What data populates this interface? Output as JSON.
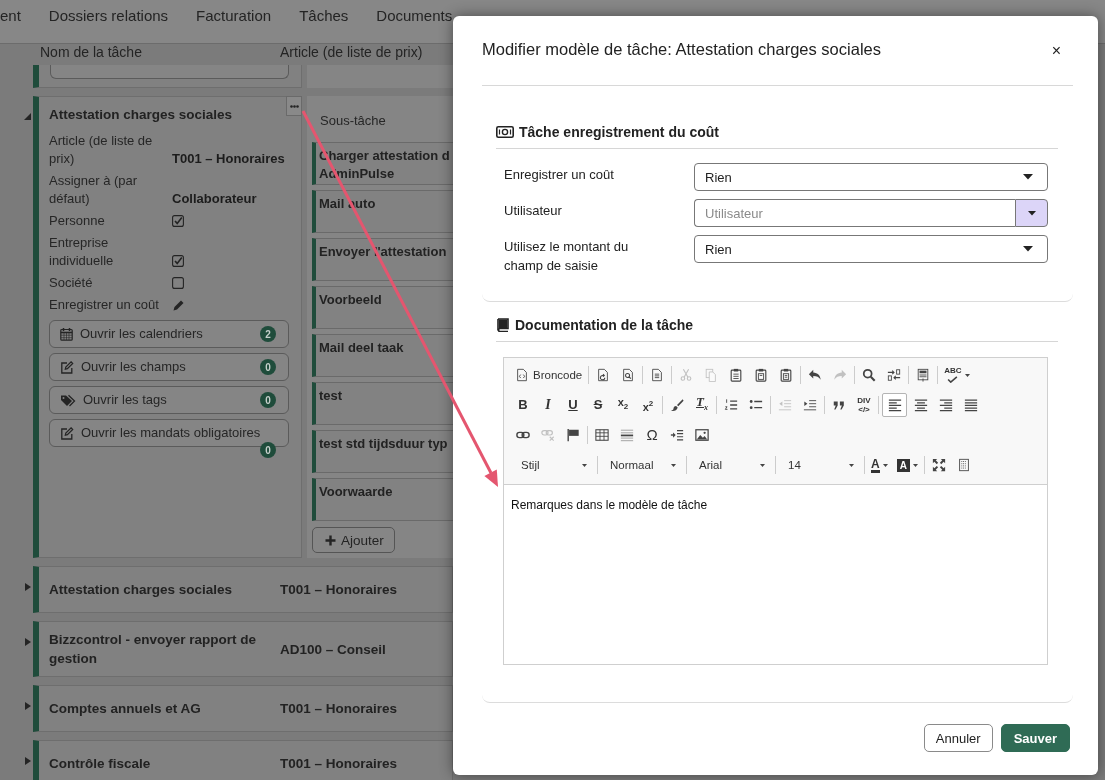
{
  "menu": [
    "ent",
    "Dossiers relations",
    "Facturation",
    "Tâches",
    "Documents"
  ],
  "columns": [
    "Nom de la tâche",
    "Article (de liste de prix)"
  ],
  "tasks": [
    {
      "name": "Attestation charges sociales",
      "expanded": true,
      "fields": [
        {
          "kind": "text",
          "label": "Article (de liste de prix)",
          "value": "T001 – Honoraires"
        },
        {
          "kind": "text",
          "label": "Assigner à (par défaut)",
          "value": "Collaborateur"
        },
        {
          "kind": "checkbox",
          "label": "Personne",
          "checked": true
        },
        {
          "kind": "checkbox",
          "label": "Entreprise individuelle",
          "checked": true
        },
        {
          "kind": "checkbox",
          "label": "Société",
          "checked": false
        },
        {
          "kind": "edit",
          "label": "Enregistrer un coût"
        }
      ],
      "buttons": [
        {
          "kind": "calendar",
          "label": "Ouvrir les calendriers",
          "count": "2"
        },
        {
          "kind": "edit",
          "label": "Ouvrir les champs",
          "count": "0"
        },
        {
          "kind": "tags",
          "label": "Ouvrir les tags",
          "count": "0"
        },
        {
          "kind": "edit",
          "label": "Ouvrir les mandats obligatoires",
          "count": "0"
        }
      ],
      "subtasks_header": "Sous-tâche",
      "subtasks": [
        "Charger attestation d AdminPulse",
        "Mail auto",
        "Envoyer l'attestation",
        "Voorbeeld",
        "Mail deel taak",
        "test",
        "test std tijdsduur typ",
        "Voorwaarde"
      ],
      "add_button": "Ajouter"
    },
    {
      "name": "Attestation charges sociales",
      "article": "T001 – Honoraires",
      "expanded": false
    },
    {
      "name": "Bizzcontrol - envoyer rapport de gestion",
      "article": "AD100 – Conseil",
      "expanded": false
    },
    {
      "name": "Comptes annuels et AG",
      "article": "T001 – Honoraires",
      "expanded": false
    },
    {
      "name": "Contrôle fiscale",
      "article": "T001 – Honoraires",
      "expanded": false
    }
  ],
  "dialog": {
    "title": "Modifier modèle de tâche: Attestation charges sociales",
    "close": "×",
    "sections": [
      {
        "kind": "cost",
        "title": "Tâche enregistrement du coût",
        "fields": [
          {
            "kind": "select",
            "label": "Enregistrer un coût",
            "value": "Rien"
          },
          {
            "kind": "combobox",
            "label": "Utilisateur",
            "placeholder": "Utilisateur"
          },
          {
            "kind": "select",
            "label": "Utilisez le montant du champ de saisie",
            "value": "Rien"
          }
        ]
      },
      {
        "kind": "docs",
        "title": "Documentation de la tâche",
        "editor": {
          "toolbar": {
            "rows": [
              {
                "groups": [
                  {
                    "items": [
                      {
                        "kind": "source",
                        "label": "Broncode",
                        "disabled": false,
                        "on": false
                      }
                    ]
                  },
                  {
                    "items": [
                      {
                        "kind": "template",
                        "disabled": false,
                        "on": false
                      },
                      {
                        "kind": "preview",
                        "disabled": false,
                        "on": false
                      }
                    ]
                  },
                  {
                    "items": [
                      {
                        "kind": "newpage",
                        "disabled": false,
                        "on": false
                      }
                    ]
                  },
                  {
                    "items": [
                      {
                        "kind": "cut",
                        "disabled": true,
                        "on": false
                      },
                      {
                        "kind": "copy",
                        "disabled": true,
                        "on": false
                      },
                      {
                        "kind": "paste",
                        "disabled": false,
                        "on": false
                      },
                      {
                        "kind": "pastetext",
                        "disabled": false,
                        "on": false
                      },
                      {
                        "kind": "pasteword",
                        "disabled": false,
                        "on": false
                      }
                    ]
                  },
                  {
                    "items": [
                      {
                        "kind": "undo",
                        "disabled": false,
                        "on": false
                      },
                      {
                        "kind": "redo",
                        "disabled": true,
                        "on": false
                      }
                    ]
                  },
                  {
                    "items": [
                      {
                        "kind": "find",
                        "disabled": false,
                        "on": false
                      },
                      {
                        "kind": "replace",
                        "disabled": false,
                        "on": false
                      }
                    ]
                  },
                  {
                    "items": [
                      {
                        "kind": "selectall",
                        "disabled": false,
                        "on": false
                      }
                    ]
                  },
                  {
                    "items": [
                      {
                        "kind": "spellcheck",
                        "label": "ABC",
                        "disabled": false,
                        "on": false
                      }
                    ]
                  }
                ]
              },
              {
                "groups": [
                  {
                    "items": [
                      {
                        "kind": "bold",
                        "label": "B",
                        "disabled": false,
                        "on": false
                      },
                      {
                        "kind": "italic",
                        "label": "I",
                        "disabled": false,
                        "on": false
                      },
                      {
                        "kind": "underline",
                        "label": "U",
                        "disabled": false,
                        "on": false
                      },
                      {
                        "kind": "strike",
                        "label": "S",
                        "disabled": false,
                        "on": false
                      },
                      {
                        "kind": "subscript",
                        "label": "x$_{2}$",
                        "disabled": false,
                        "on": false
                      },
                      {
                        "kind": "superscript",
                        "label": "x$^{2}$",
                        "disabled": false,
                        "on": false
                      }
                    ]
                  },
                  {
                    "items": [
                      {
                        "kind": "brush",
                        "disabled": false,
                        "on": false
                      },
                      {
                        "kind": "removeformat",
                        "label": "T$_{x}$",
                        "disabled": false,
                        "on": false
                      }
                    ]
                  },
                  {
                    "items": [
                      {
                        "kind": "numbered",
                        "disabled": false,
                        "on": false
                      },
                      {
                        "kind": "bulleted",
                        "disabled": false,
                        "on": false
                      }
                    ]
                  },
                  {
                    "items": [
                      {
                        "kind": "outdent",
                        "disabled": true,
                        "on": false
                      },
                      {
                        "kind": "indent",
                        "disabled": false,
                        "on": false
                      }
                    ]
                  },
                  {
                    "items": [
                      {
                        "kind": "quote",
                        "disabled": false,
                        "on": false
                      },
                      {
                        "kind": "div",
                        "label": "DIV",
                        "sublabel": "</>",
                        "disabled": false,
                        "on": false
                      }
                    ]
                  },
                  {
                    "items": [
                      {
                        "kind": "alignleft",
                        "disabled": false,
                        "on": true
                      },
                      {
                        "kind": "aligncenter",
                        "disabled": false,
                        "on": false
                      },
                      {
                        "kind": "alignright",
                        "disabled": false,
                        "on": false
                      },
                      {
                        "kind": "justify",
                        "disabled": false,
                        "on": false
                      }
                    ]
                  }
                ]
              },
              {
                "groups": [
                  {
                    "items": [
                      {
                        "kind": "link",
                        "disabled": false,
                        "on": false
                      },
                      {
                        "kind": "unlink",
                        "disabled": true,
                        "on": false
                      },
                      {
                        "kind": "anchor",
                        "disabled": false,
                        "on": false
                      }
                    ]
                  },
                  {
                    "items": [
                      {
                        "kind": "table",
                        "disabled": false,
                        "on": false
                      },
                      {
                        "kind": "hr",
                        "disabled": false,
                        "on": false
                      },
                      {
                        "kind": "specialchar",
                        "label": "Ω",
                        "disabled": false,
                        "on": false
                      },
                      {
                        "kind": "pagebreak",
                        "disabled": false,
                        "on": false
                      },
                      {
                        "kind": "image",
                        "disabled": false,
                        "on": false
                      }
                    ]
                  }
                ]
              },
              {
                "groups": [
                  {
                    "items": [
                      {
                        "kind": "combo",
                        "label": "Stijl",
                        "disabled": false,
                        "on": false
                      }
                    ]
                  },
                  {
                    "items": [
                      {
                        "kind": "combo",
                        "label": "Normaal",
                        "disabled": false,
                        "on": false
                      }
                    ]
                  },
                  {
                    "items": [
                      {
                        "kind": "combo",
                        "label": "Arial",
                        "disabled": false,
                        "on": false
                      }
                    ]
                  },
                  {
                    "items": [
                      {
                        "kind": "combo",
                        "label": "14",
                        "disabled": false,
                        "on": false
                      }
                    ]
                  },
                  {
                    "items": [
                      {
                        "kind": "textcolor",
                        "label": "A",
                        "disabled": false,
                        "on": false
                      },
                      {
                        "kind": "bgcolor",
                        "label": "A",
                        "disabled": false,
                        "on": false
                      }
                    ]
                  },
                  {
                    "items": [
                      {
                        "kind": "maximize",
                        "disabled": false,
                        "on": false
                      },
                      {
                        "kind": "showblocks",
                        "disabled": false,
                        "on": false
                      }
                    ]
                  }
                ]
              }
            ]
          },
          "content": "Remarques dans le modèle de tâche"
        }
      }
    ],
    "buttons": [
      {
        "kind": "secondary",
        "label": "Annuler"
      },
      {
        "kind": "primary",
        "label": "Sauver"
      }
    ]
  }
}
